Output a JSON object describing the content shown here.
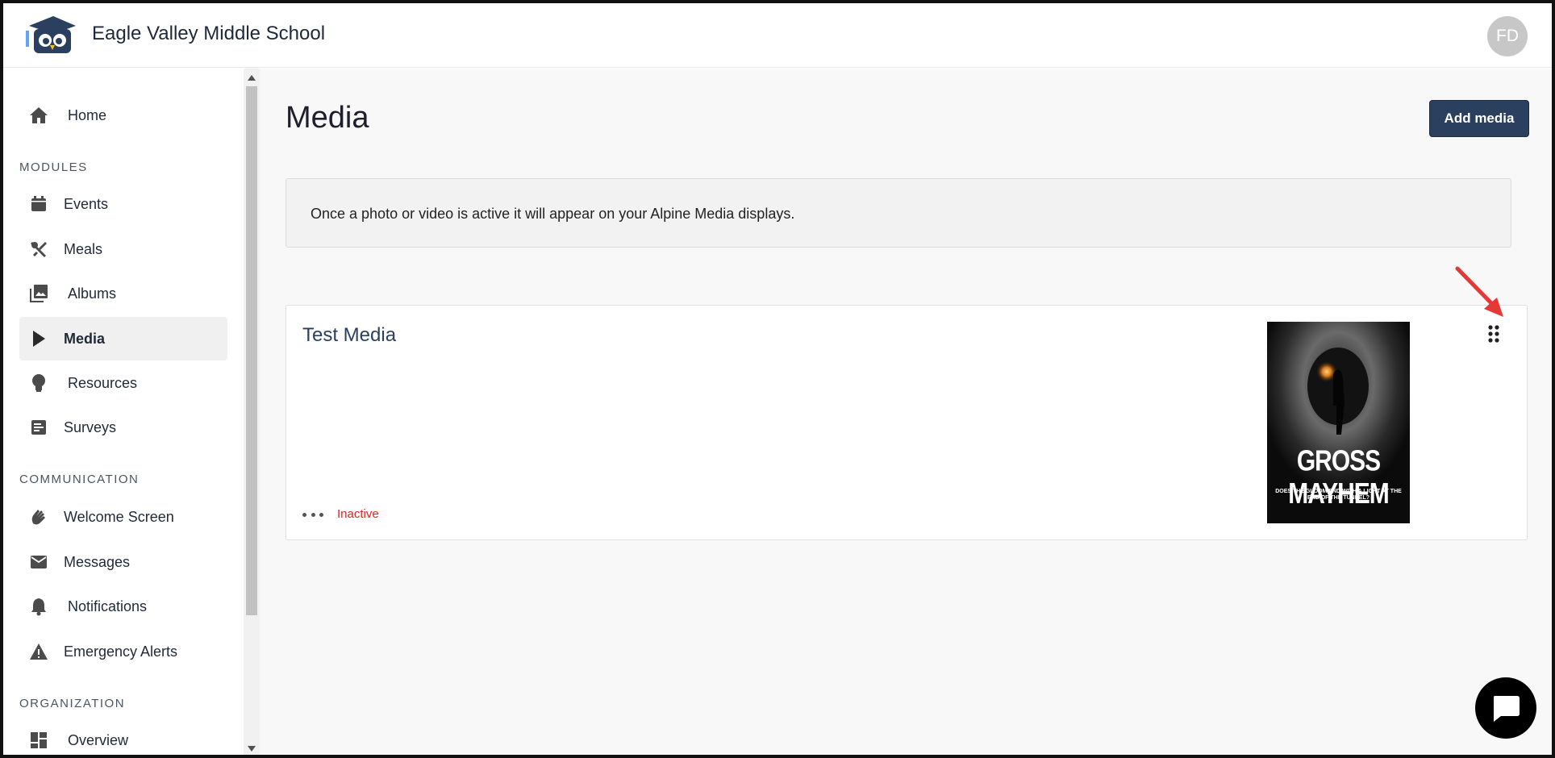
{
  "header": {
    "school_name": "Eagle Valley Middle School",
    "avatar_initials": "FD"
  },
  "sidebar": {
    "home": "Home",
    "sections": {
      "modules": "MODULES",
      "communication": "COMMUNICATION",
      "organization": "ORGANIZATION"
    },
    "modules": [
      {
        "label": "Events",
        "icon": "calendar-icon"
      },
      {
        "label": "Meals",
        "icon": "utensils-icon"
      },
      {
        "label": "Albums",
        "icon": "photo-library-icon"
      },
      {
        "label": "Media",
        "icon": "play-icon",
        "active": true
      },
      {
        "label": "Resources",
        "icon": "lightbulb-icon"
      },
      {
        "label": "Surveys",
        "icon": "survey-icon"
      }
    ],
    "communication": [
      {
        "label": "Welcome Screen",
        "icon": "wave-hand-icon"
      },
      {
        "label": "Messages",
        "icon": "mail-icon"
      },
      {
        "label": "Notifications",
        "icon": "bell-icon"
      },
      {
        "label": "Emergency Alerts",
        "icon": "warning-icon"
      }
    ],
    "organization": [
      {
        "label": "Overview",
        "icon": "dashboard-icon"
      }
    ]
  },
  "main": {
    "title": "Media",
    "add_button": "Add media",
    "info_text": "Once a photo or video is active it will appear on your Alpine Media displays.",
    "card": {
      "title": "Test Media",
      "status": "Inactive",
      "thumbnail": {
        "title": "GROSS MAYHEM",
        "subtitle": "DOES THE GLOOM END WITH A LIGHT AT THE END OF THE TUNNEL?"
      }
    }
  },
  "colors": {
    "primary": "#2b3f5f",
    "inactive": "#d62828",
    "annotation_arrow": "#e53935"
  }
}
